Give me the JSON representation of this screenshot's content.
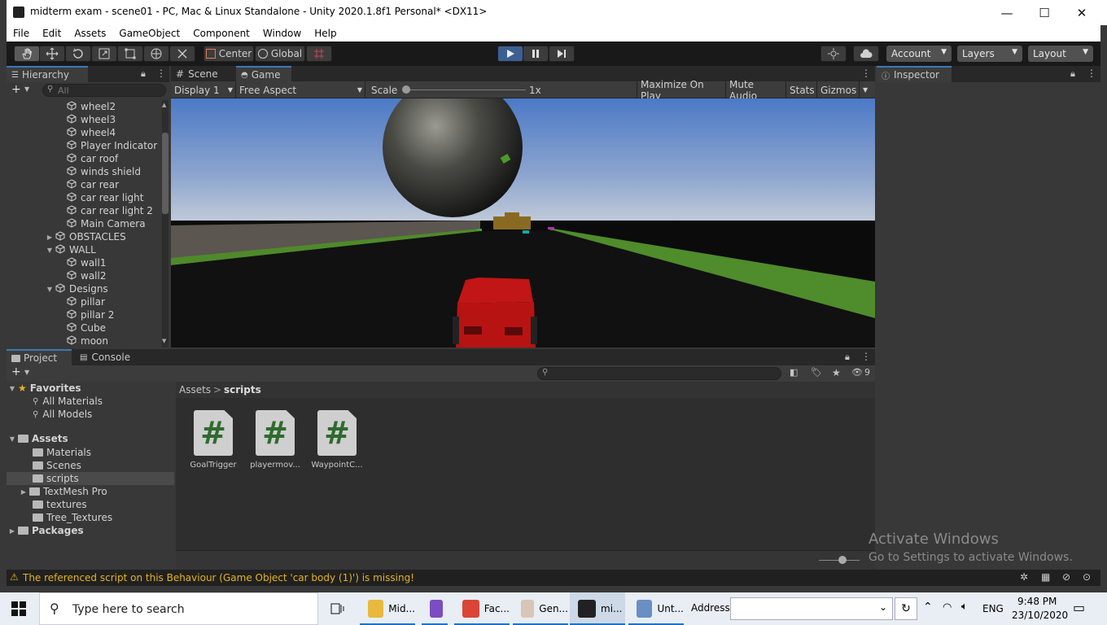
{
  "window": {
    "title": "midterm exam - scene01 - PC, Mac & Linux Standalone - Unity 2020.1.8f1 Personal* <DX11>",
    "minimize": "—",
    "maximize": "☐",
    "close": "✕"
  },
  "menu": [
    "File",
    "Edit",
    "Assets",
    "GameObject",
    "Component",
    "Window",
    "Help"
  ],
  "toolbar": {
    "pivot": "Center",
    "space": "Global",
    "account": "Account",
    "layers": "Layers",
    "layout": "Layout"
  },
  "hierarchy": {
    "tab": "Hierarchy",
    "search_placeholder": "All",
    "items": [
      {
        "label": "wheel2",
        "depth": 2,
        "arrow": ""
      },
      {
        "label": "wheel3",
        "depth": 2,
        "arrow": ""
      },
      {
        "label": "wheel4",
        "depth": 2,
        "arrow": ""
      },
      {
        "label": "Player Indicator",
        "depth": 2,
        "arrow": ""
      },
      {
        "label": "car roof",
        "depth": 2,
        "arrow": ""
      },
      {
        "label": "winds shield",
        "depth": 2,
        "arrow": ""
      },
      {
        "label": "car rear",
        "depth": 2,
        "arrow": ""
      },
      {
        "label": "car rear light",
        "depth": 2,
        "arrow": ""
      },
      {
        "label": "car rear light 2",
        "depth": 2,
        "arrow": ""
      },
      {
        "label": "Main Camera",
        "depth": 2,
        "arrow": ""
      },
      {
        "label": "OBSTACLES",
        "depth": 1,
        "arrow": "▶"
      },
      {
        "label": "WALL",
        "depth": 1,
        "arrow": "▼"
      },
      {
        "label": "wall1",
        "depth": 2,
        "arrow": ""
      },
      {
        "label": "wall2",
        "depth": 2,
        "arrow": ""
      },
      {
        "label": "Designs",
        "depth": 1,
        "arrow": "▼"
      },
      {
        "label": "pillar",
        "depth": 2,
        "arrow": ""
      },
      {
        "label": "pillar 2",
        "depth": 2,
        "arrow": ""
      },
      {
        "label": "Cube",
        "depth": 2,
        "arrow": ""
      },
      {
        "label": "moon",
        "depth": 2,
        "arrow": ""
      }
    ]
  },
  "center_tabs": {
    "scene": "Scene",
    "game": "Game"
  },
  "game_toolbar": {
    "display": "Display 1",
    "aspect": "Free Aspect",
    "scale_label": "Scale",
    "scale_value": "1x",
    "maximize": "Maximize On Play",
    "mute": "Mute Audio",
    "stats": "Stats",
    "gizmos": "Gizmos"
  },
  "inspector": {
    "tab": "Inspector"
  },
  "bottom_tabs": {
    "project": "Project",
    "console": "Console"
  },
  "project": {
    "favorites_label": "Favorites",
    "favorites": [
      "All Materials",
      "All Models"
    ],
    "assets_label": "Assets",
    "folders": [
      {
        "label": "Materials",
        "arrow": "",
        "selected": false
      },
      {
        "label": "Scenes",
        "arrow": "",
        "selected": false
      },
      {
        "label": "scripts",
        "arrow": "",
        "selected": true
      },
      {
        "label": "TextMesh Pro",
        "arrow": "▶",
        "selected": false
      },
      {
        "label": "textures",
        "arrow": "",
        "selected": false
      },
      {
        "label": "Tree_Textures",
        "arrow": "",
        "selected": false
      }
    ],
    "packages_label": "Packages",
    "breadcrumb_root": "Assets",
    "breadcrumb_sep": ">",
    "breadcrumb_current": "scripts",
    "hidden_count": "9",
    "assets": [
      {
        "label": "GoalTrigger",
        "glyph": "#"
      },
      {
        "label": "playermov...",
        "glyph": "#"
      },
      {
        "label": "WaypointC...",
        "glyph": "#"
      }
    ]
  },
  "watermark": {
    "line1": "Activate Windows",
    "line2": "Go to Settings to activate Windows."
  },
  "status": {
    "message": "The referenced script on this Behaviour (Game Object 'car body (1)') is missing!"
  },
  "taskbar": {
    "search_placeholder": "Type here to search",
    "apps": [
      {
        "label": "Mid...",
        "color": "#e8b93c"
      },
      {
        "label": "",
        "color": "#7b4cc2"
      },
      {
        "label": "Fac...",
        "color": "#db4437"
      },
      {
        "label": "Gen...",
        "color": "#d9c5b8"
      },
      {
        "label": "mi...",
        "color": "#222222"
      },
      {
        "label": "Unt...",
        "color": "#6a8fc2"
      }
    ],
    "address_label": "Address",
    "lang": "ENG",
    "time": "9:48 PM",
    "date": "23/10/2020"
  }
}
